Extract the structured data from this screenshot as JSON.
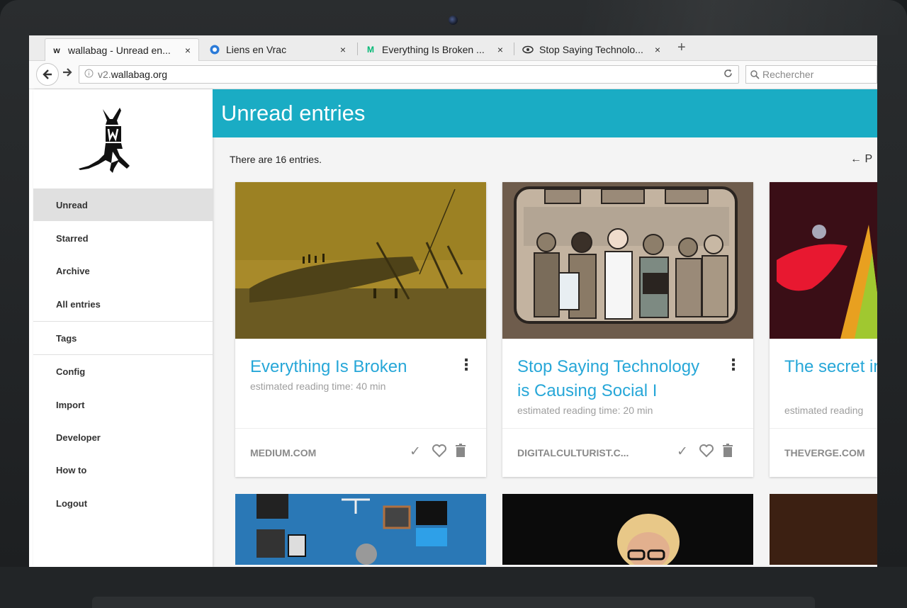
{
  "browser": {
    "tabs": [
      {
        "title": "wallabag - Unread en...",
        "favicon": "w"
      },
      {
        "title": "Liens en Vrac",
        "favicon": "circle"
      },
      {
        "title": "Everything Is Broken ...",
        "favicon": "M"
      },
      {
        "title": "Stop Saying Technolo...",
        "favicon": "eye"
      }
    ],
    "close_glyph": "×",
    "new_tab_glyph": "+",
    "url_prefix": "v2.",
    "url_domain": "wallabag.org",
    "search_placeholder": "Rechercher"
  },
  "sidebar": {
    "items": [
      {
        "label": "Unread",
        "active": true
      },
      {
        "label": "Starred"
      },
      {
        "label": "Archive"
      },
      {
        "label": "All entries"
      },
      {
        "label": "Tags"
      },
      {
        "label": "Config"
      },
      {
        "label": "Import"
      },
      {
        "label": "Developer"
      },
      {
        "label": "How to"
      },
      {
        "label": "Logout"
      }
    ]
  },
  "header": {
    "title": "Unread entries"
  },
  "main": {
    "count_text": "There are 16 entries.",
    "pager_text": "← P"
  },
  "cards": [
    {
      "title": "Everything Is Broken",
      "reading_time": "estimated reading time: 40 min",
      "domain": "MEDIUM.COM"
    },
    {
      "title": "Stop Saying Technology is Causing Social I",
      "reading_time": "estimated reading time: 20 min",
      "domain": "DIGITALCULTURIST.C..."
    },
    {
      "title": "The secret internet",
      "reading_time": "estimated reading",
      "domain": "THEVERGE.COM"
    }
  ],
  "colors": {
    "accent": "#1aacc4",
    "link": "#27a7d8"
  }
}
